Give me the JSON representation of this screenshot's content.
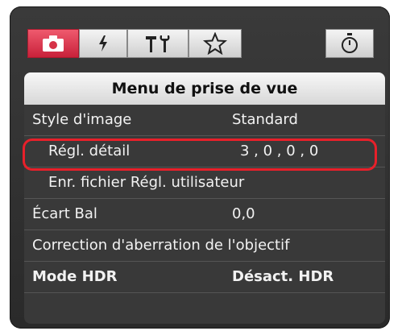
{
  "tabs": [
    {
      "icon": "camera-icon",
      "active": true
    },
    {
      "icon": "flash-icon",
      "active": false
    },
    {
      "icon": "tools-icon",
      "active": false
    },
    {
      "icon": "star-icon",
      "active": false
    },
    {
      "icon": "timer-icon",
      "active": false
    }
  ],
  "colors": {
    "active_tab": "#d63248",
    "highlight": "#e8202a",
    "menu_bg": "#393939"
  },
  "menu": {
    "title": "Menu de prise de vue",
    "items": [
      {
        "label": "Style d'image",
        "value": "Standard"
      },
      {
        "label": "Régl. détail",
        "value": "3 , 0 , 0 , 0",
        "highlighted": true
      },
      {
        "label": "Enr. fichier Régl. utilisateur",
        "value": ""
      },
      {
        "label": "Écart Bal",
        "value": "0,0"
      },
      {
        "label": "Correction d'aberration de l'objectif",
        "value": ""
      },
      {
        "label": "Mode HDR",
        "value": "Désact. HDR"
      }
    ]
  }
}
